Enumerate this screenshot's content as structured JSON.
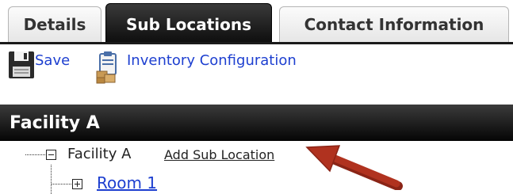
{
  "tabs": [
    {
      "label": "Details",
      "active": false
    },
    {
      "label": "Sub Locations",
      "active": true
    },
    {
      "label": "Contact Information",
      "active": false
    }
  ],
  "toolbar": {
    "save_label": "Save",
    "save_icon": "floppy-disk-icon",
    "inventory_label": "Inventory Configuration",
    "inventory_icon": "clipboard-boxes-icon"
  },
  "section": {
    "title": "Facility A"
  },
  "tree": {
    "root": {
      "label": "Facility A",
      "expanded": true,
      "action_label": "Add Sub Location"
    },
    "children": [
      {
        "label": "Room 1",
        "expanded": false
      }
    ]
  },
  "colors": {
    "link": "#1d3fd0",
    "header_bg": "#111111",
    "arrow": "#b0321f"
  }
}
